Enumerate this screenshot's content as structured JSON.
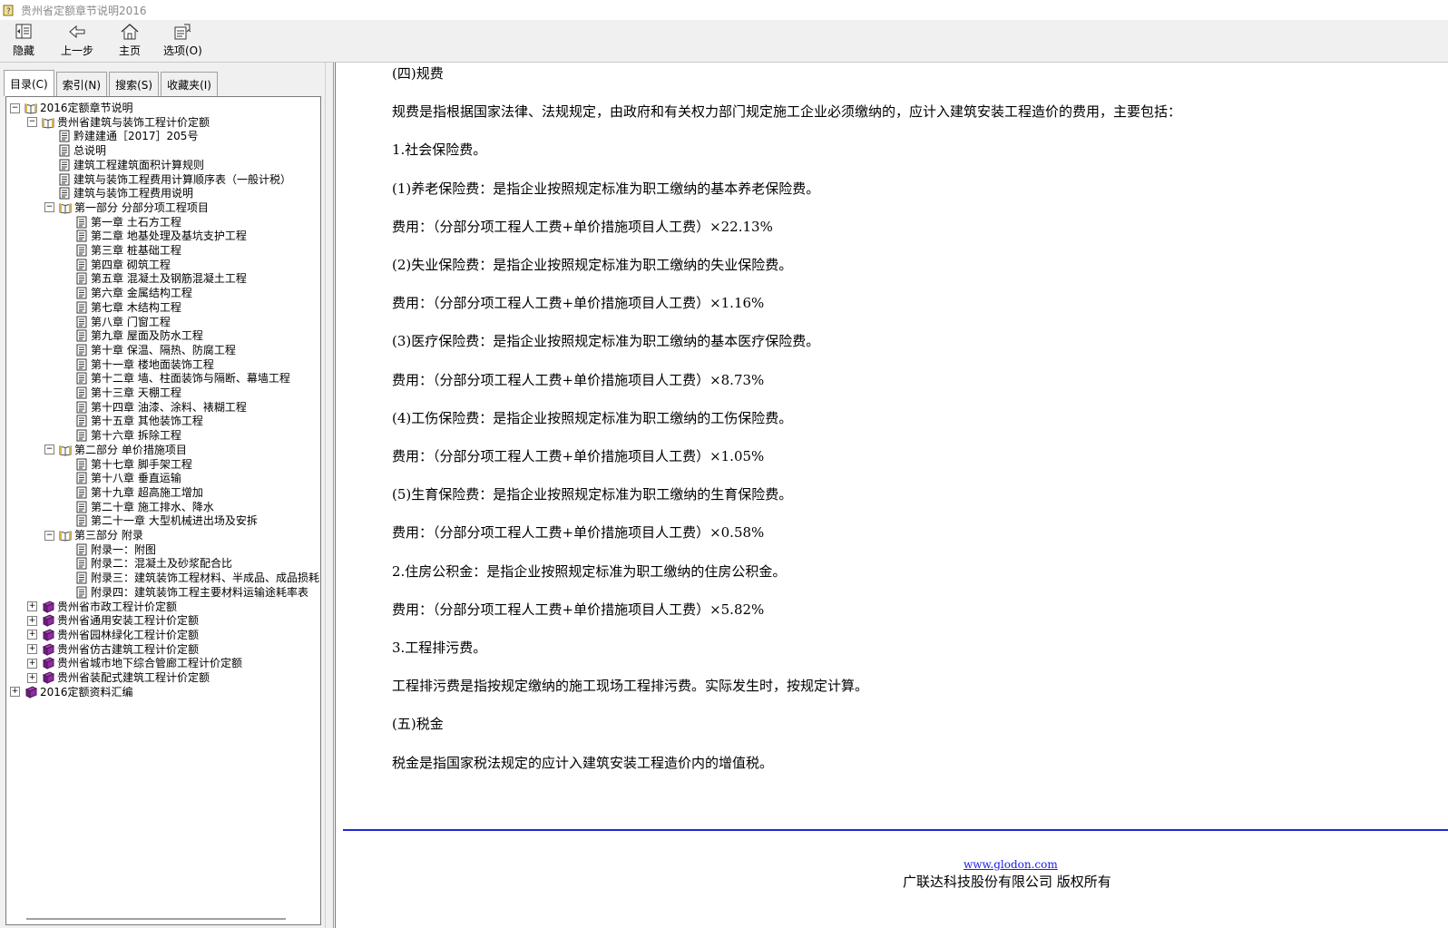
{
  "window": {
    "title": "贵州省定额章节说明2016"
  },
  "toolbar": {
    "hide_label": "隐藏",
    "back_label": "上一步",
    "home_label": "主页",
    "options_label": "选项(O)"
  },
  "tabs": [
    "目录(C)",
    "索引(N)",
    "搜索(S)",
    "收藏夹(I)"
  ],
  "tree": [
    {
      "label": "2016定额章节说明",
      "level": 0,
      "icon": "open-book-icon",
      "exp": "−"
    },
    {
      "label": "贵州省建筑与装饰工程计价定额",
      "level": 1,
      "icon": "open-book-icon",
      "exp": "−"
    },
    {
      "label": "黔建建通［2017］205号",
      "level": 2,
      "icon": "page-icon",
      "exp": ""
    },
    {
      "label": "总说明",
      "level": 2,
      "icon": "page-icon",
      "exp": ""
    },
    {
      "label": "建筑工程建筑面积计算规则",
      "level": 2,
      "icon": "page-icon",
      "exp": ""
    },
    {
      "label": "建筑与装饰工程费用计算顺序表（一般计税）",
      "level": 2,
      "icon": "page-icon",
      "exp": ""
    },
    {
      "label": "建筑与装饰工程费用说明",
      "level": 2,
      "icon": "page-icon",
      "exp": ""
    },
    {
      "label": "第一部分 分部分项工程项目",
      "level": 2,
      "icon": "open-book-icon",
      "exp": "−"
    },
    {
      "label": "第一章 土石方工程",
      "level": 3,
      "icon": "page-icon",
      "exp": ""
    },
    {
      "label": "第二章 地基处理及基坑支护工程",
      "level": 3,
      "icon": "page-icon",
      "exp": ""
    },
    {
      "label": "第三章 桩基础工程",
      "level": 3,
      "icon": "page-icon",
      "exp": ""
    },
    {
      "label": "第四章 砌筑工程",
      "level": 3,
      "icon": "page-icon",
      "exp": ""
    },
    {
      "label": "第五章 混凝土及钢筋混凝土工程",
      "level": 3,
      "icon": "page-icon",
      "exp": ""
    },
    {
      "label": "第六章 金属结构工程",
      "level": 3,
      "icon": "page-icon",
      "exp": ""
    },
    {
      "label": "第七章 木结构工程",
      "level": 3,
      "icon": "page-icon",
      "exp": ""
    },
    {
      "label": "第八章 门窗工程",
      "level": 3,
      "icon": "page-icon",
      "exp": ""
    },
    {
      "label": "第九章 屋面及防水工程",
      "level": 3,
      "icon": "page-icon",
      "exp": ""
    },
    {
      "label": "第十章 保温、隔热、防腐工程",
      "level": 3,
      "icon": "page-icon",
      "exp": ""
    },
    {
      "label": "第十一章 楼地面装饰工程",
      "level": 3,
      "icon": "page-icon",
      "exp": ""
    },
    {
      "label": "第十二章 墙、柱面装饰与隔断、幕墙工程",
      "level": 3,
      "icon": "page-icon",
      "exp": ""
    },
    {
      "label": "第十三章 天棚工程",
      "level": 3,
      "icon": "page-icon",
      "exp": ""
    },
    {
      "label": "第十四章 油漆、涂料、裱糊工程",
      "level": 3,
      "icon": "page-icon",
      "exp": ""
    },
    {
      "label": "第十五章 其他装饰工程",
      "level": 3,
      "icon": "page-icon",
      "exp": ""
    },
    {
      "label": "第十六章 拆除工程",
      "level": 3,
      "icon": "page-icon",
      "exp": ""
    },
    {
      "label": "第二部分 单价措施项目",
      "level": 2,
      "icon": "open-book-icon",
      "exp": "−"
    },
    {
      "label": "第十七章 脚手架工程",
      "level": 3,
      "icon": "page-icon",
      "exp": ""
    },
    {
      "label": "第十八章 垂直运输",
      "level": 3,
      "icon": "page-icon",
      "exp": ""
    },
    {
      "label": "第十九章 超高施工增加",
      "level": 3,
      "icon": "page-icon",
      "exp": ""
    },
    {
      "label": "第二十章 施工排水、降水",
      "level": 3,
      "icon": "page-icon",
      "exp": ""
    },
    {
      "label": "第二十一章 大型机械进出场及安拆",
      "level": 3,
      "icon": "page-icon",
      "exp": ""
    },
    {
      "label": "第三部分 附录",
      "level": 2,
      "icon": "open-book-icon",
      "exp": "−"
    },
    {
      "label": "附录一：附图",
      "level": 3,
      "icon": "page-icon",
      "exp": ""
    },
    {
      "label": "附录二：混凝土及砂浆配合比",
      "level": 3,
      "icon": "page-icon",
      "exp": ""
    },
    {
      "label": "附录三：建筑装饰工程材料、半成品、成品损耗",
      "level": 3,
      "icon": "page-icon",
      "exp": ""
    },
    {
      "label": "附录四：建筑装饰工程主要材料运输途耗率表",
      "level": 3,
      "icon": "page-icon",
      "exp": ""
    },
    {
      "label": "贵州省市政工程计价定额",
      "level": 1,
      "icon": "closed-book-icon",
      "exp": "+"
    },
    {
      "label": "贵州省通用安装工程计价定额",
      "level": 1,
      "icon": "closed-book-icon",
      "exp": "+"
    },
    {
      "label": "贵州省园林绿化工程计价定额",
      "level": 1,
      "icon": "closed-book-icon",
      "exp": "+"
    },
    {
      "label": "贵州省仿古建筑工程计价定额",
      "level": 1,
      "icon": "closed-book-icon",
      "exp": "+"
    },
    {
      "label": "贵州省城市地下综合管廊工程计价定额",
      "level": 1,
      "icon": "closed-book-icon",
      "exp": "+"
    },
    {
      "label": "贵州省装配式建筑工程计价定额",
      "level": 1,
      "icon": "closed-book-icon",
      "exp": "+"
    },
    {
      "label": "2016定额资料汇编",
      "level": 0,
      "icon": "closed-book-icon",
      "exp": "+"
    }
  ],
  "content": {
    "paragraphs": [
      "(四)规费",
      "规费是指根据国家法律、法规规定，由政府和有关权力部门规定施工企业必须缴纳的，应计入建筑安装工程造价的费用，主要包括：",
      "1.社会保险费。",
      "(1)养老保险费：是指企业按照规定标准为职工缴纳的基本养老保险费。",
      "费用：（分部分项工程人工费+单价措施项目人工费）×22.13%",
      "(2)失业保险费：是指企业按照规定标准为职工缴纳的失业保险费。",
      "费用：（分部分项工程人工费+单价措施项目人工费）×1.16%",
      "(3)医疗保险费：是指企业按照规定标准为职工缴纳的基本医疗保险费。",
      "费用：（分部分项工程人工费+单价措施项目人工费）×8.73%",
      "(4)工伤保险费：是指企业按照规定标准为职工缴纳的工伤保险费。",
      "费用：（分部分项工程人工费+单价措施项目人工费）×1.05%",
      "(5)生育保险费：是指企业按照规定标准为职工缴纳的生育保险费。",
      "费用：（分部分项工程人工费+单价措施项目人工费）×0.58%",
      "2.住房公积金：是指企业按照规定标准为职工缴纳的住房公积金。",
      "费用：（分部分项工程人工费+单价措施项目人工费）×5.82%",
      "3.工程排污费。",
      "工程排污费是指按规定缴纳的施工现场工程排污费。实际发生时，按规定计算。",
      "(五)税金",
      "税金是指国家税法规定的应计入建筑安装工程造价内的增值税。"
    ],
    "footer_link": "www.glodon.com",
    "footer_copyright": "广联达科技股份有限公司 版权所有"
  }
}
